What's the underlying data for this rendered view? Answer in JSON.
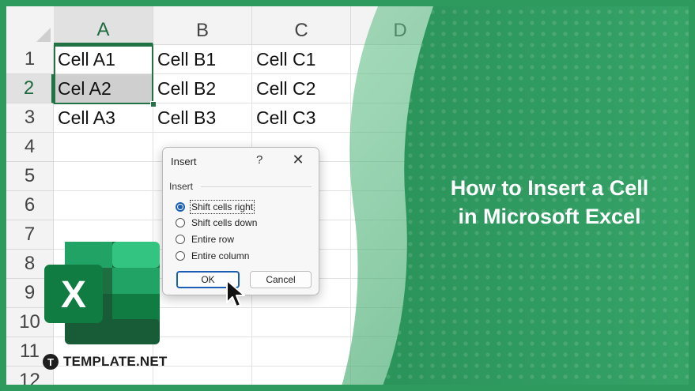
{
  "spreadsheet": {
    "columns": [
      "A",
      "B",
      "C",
      "D"
    ],
    "rows": [
      "1",
      "2",
      "3",
      "4",
      "5",
      "6",
      "7",
      "8",
      "9",
      "10",
      "11",
      "12"
    ],
    "cells": [
      [
        "Cell A1",
        "Cell B1",
        "Cell C1"
      ],
      [
        "Cel A2",
        "Cell B2",
        "Cell C2"
      ],
      [
        "Cell A3",
        "Cell B3",
        "Cell C3"
      ]
    ]
  },
  "dialog": {
    "title": "Insert",
    "help": "?",
    "close": "✕",
    "group_label": "Insert",
    "options": [
      {
        "label": "Shift cells right",
        "selected": true
      },
      {
        "label": "Shift cells down",
        "selected": false
      },
      {
        "label": "Entire row",
        "selected": false
      },
      {
        "label": "Entire column",
        "selected": false
      }
    ],
    "ok_label": "OK",
    "cancel_label": "Cancel"
  },
  "logo": {
    "letter": "X"
  },
  "brand": {
    "badge": "T",
    "name": "TEMPLATE.NET"
  },
  "headline": {
    "line1": "How to Insert a Cell",
    "line2": "in Microsoft Excel"
  },
  "colors": {
    "frame": "#2f9a5d",
    "excel_green": "#217346",
    "accent_blue": "#1a5fb4",
    "panel_green": "#2e9b62"
  }
}
